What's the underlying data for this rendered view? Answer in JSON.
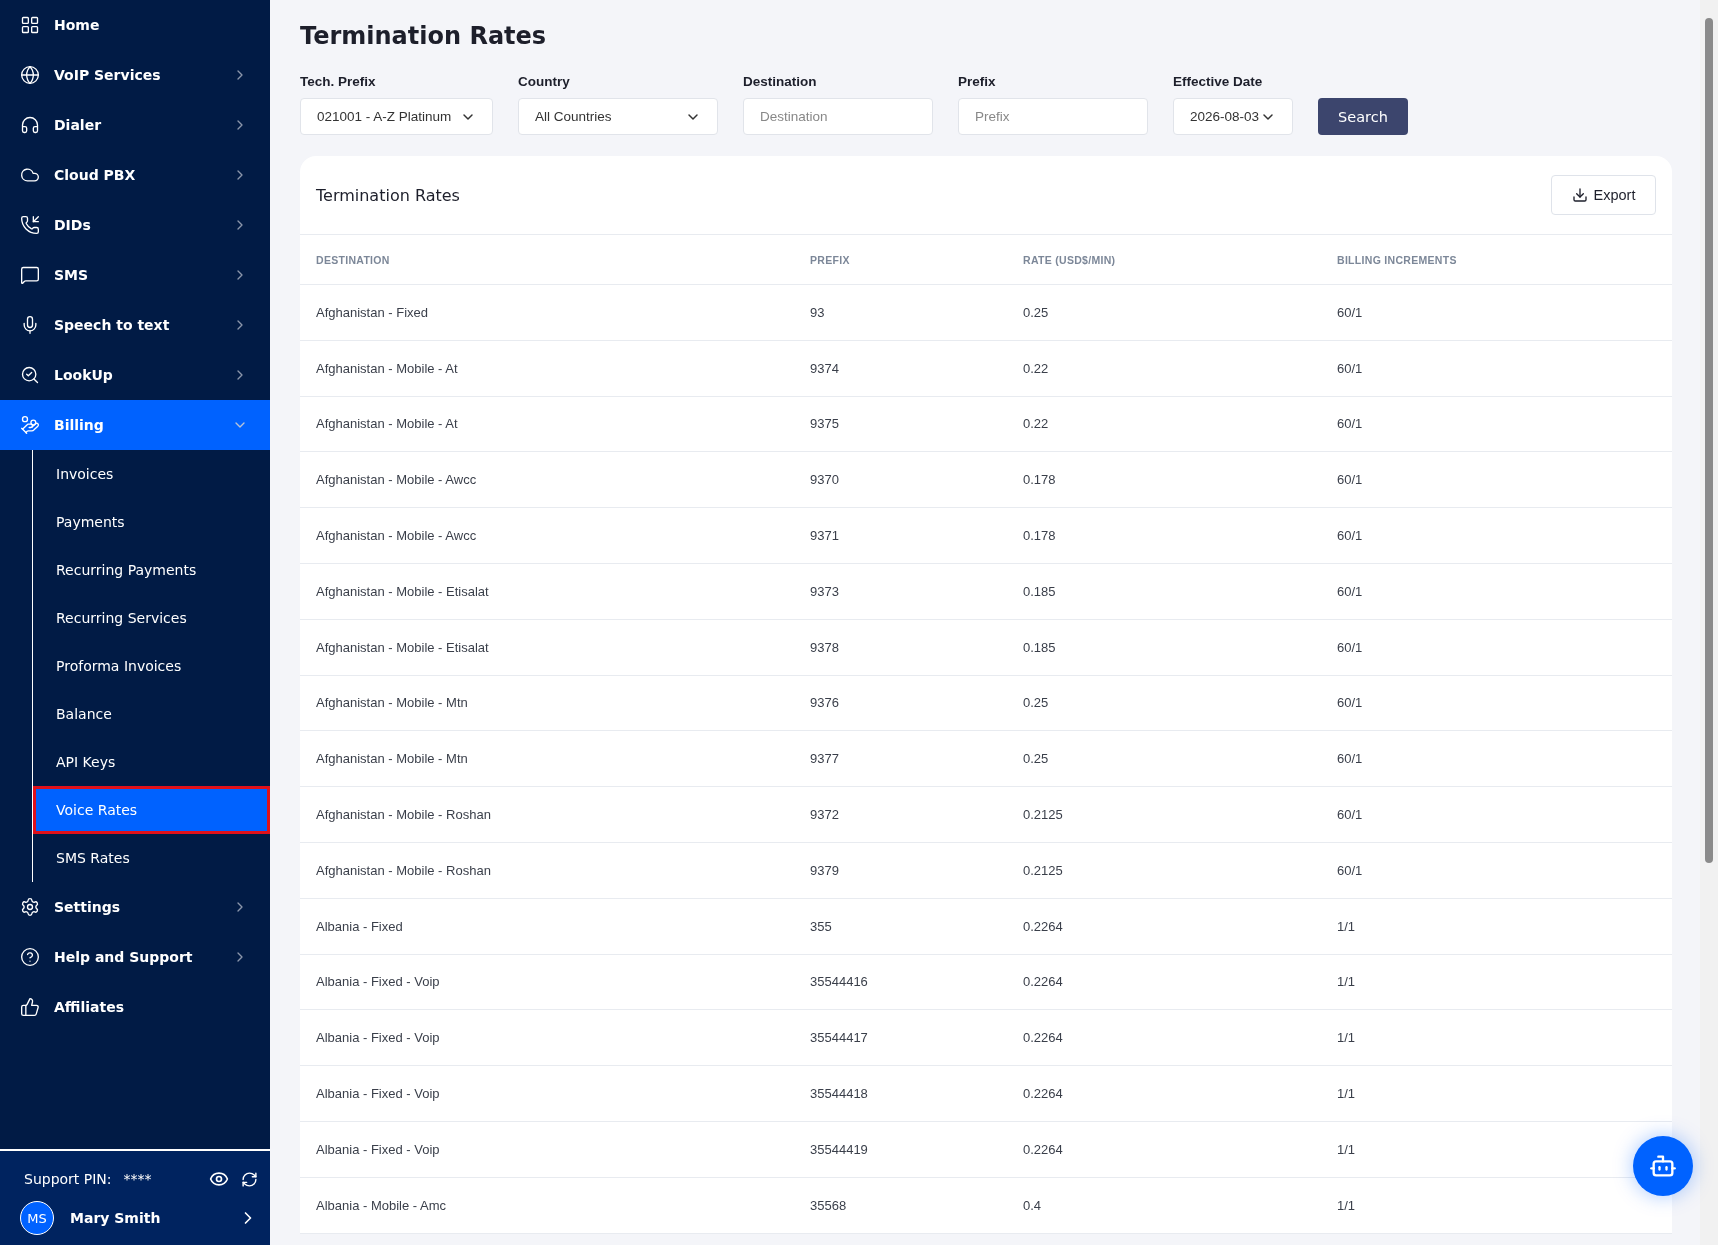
{
  "sidebar": {
    "items": [
      {
        "label": "Home",
        "kind": "link"
      },
      {
        "label": "VoIP Services",
        "kind": "menu",
        "expanded": false
      },
      {
        "label": "Dialer",
        "kind": "menu",
        "expanded": false
      },
      {
        "label": "Cloud PBX",
        "kind": "menu",
        "expanded": false
      },
      {
        "label": "DIDs",
        "kind": "menu",
        "expanded": false
      },
      {
        "label": "SMS",
        "kind": "menu",
        "expanded": false
      },
      {
        "label": "Speech to text",
        "kind": "menu",
        "expanded": false
      },
      {
        "label": "LookUp",
        "kind": "menu",
        "expanded": false
      },
      {
        "label": "Billing",
        "kind": "menu",
        "expanded": true,
        "children": [
          {
            "label": "Invoices",
            "selected": false
          },
          {
            "label": "Payments",
            "selected": false
          },
          {
            "label": "Recurring Payments",
            "selected": false
          },
          {
            "label": "Recurring Services",
            "selected": false
          },
          {
            "label": "Proforma Invoices",
            "selected": false
          },
          {
            "label": "Balance",
            "selected": false
          },
          {
            "label": "API Keys",
            "selected": false
          },
          {
            "label": "Voice Rates",
            "selected": true
          },
          {
            "label": "SMS Rates",
            "selected": false
          }
        ]
      },
      {
        "label": "Settings",
        "kind": "menu",
        "expanded": false
      },
      {
        "label": "Help and Support",
        "kind": "menu",
        "expanded": false
      },
      {
        "label": "Affiliates",
        "kind": "link"
      }
    ],
    "footer": {
      "pin_label": "Support PIN:",
      "pin_value": "****",
      "user_initials": "MS",
      "user_name": "Mary Smith"
    }
  },
  "page_title": "Termination Rates",
  "filters": [
    {
      "label": "Tech. Prefix",
      "kind": "select",
      "value": "021001 - A-Z Platinum"
    },
    {
      "label": "Country",
      "kind": "select",
      "value": "All Countries"
    },
    {
      "label": "Destination",
      "kind": "input",
      "placeholder": "Destination"
    },
    {
      "label": "Prefix",
      "kind": "input",
      "placeholder": "Prefix"
    },
    {
      "label": "Effective Date",
      "kind": "select",
      "value": "2026-08-03"
    }
  ],
  "search_button": "Search",
  "card": {
    "title": "Termination Rates",
    "export_button": "Export",
    "table": {
      "columns": [
        "DESTINATION",
        "PREFIX",
        "RATE (USD$/MIN)",
        "BILLING INCREMENTS"
      ],
      "rows": [
        [
          "Afghanistan - Fixed",
          "93",
          "0.25",
          "60/1"
        ],
        [
          "Afghanistan - Mobile - At",
          "9374",
          "0.22",
          "60/1"
        ],
        [
          "Afghanistan - Mobile - At",
          "9375",
          "0.22",
          "60/1"
        ],
        [
          "Afghanistan - Mobile - Awcc",
          "9370",
          "0.178",
          "60/1"
        ],
        [
          "Afghanistan - Mobile - Awcc",
          "9371",
          "0.178",
          "60/1"
        ],
        [
          "Afghanistan - Mobile - Etisalat",
          "9373",
          "0.185",
          "60/1"
        ],
        [
          "Afghanistan - Mobile - Etisalat",
          "9378",
          "0.185",
          "60/1"
        ],
        [
          "Afghanistan - Mobile - Mtn",
          "9376",
          "0.25",
          "60/1"
        ],
        [
          "Afghanistan - Mobile - Mtn",
          "9377",
          "0.25",
          "60/1"
        ],
        [
          "Afghanistan - Mobile - Roshan",
          "9372",
          "0.2125",
          "60/1"
        ],
        [
          "Afghanistan - Mobile - Roshan",
          "9379",
          "0.2125",
          "60/1"
        ],
        [
          "Albania - Fixed",
          "355",
          "0.2264",
          "1/1"
        ],
        [
          "Albania - Fixed - Voip",
          "35544416",
          "0.2264",
          "1/1"
        ],
        [
          "Albania - Fixed - Voip",
          "35544417",
          "0.2264",
          "1/1"
        ],
        [
          "Albania - Fixed - Voip",
          "35544418",
          "0.2264",
          "1/1"
        ],
        [
          "Albania - Fixed - Voip",
          "35544419",
          "0.2264",
          "1/1"
        ],
        [
          "Albania - Mobile - Amc",
          "35568",
          "0.4",
          "1/1"
        ]
      ]
    }
  }
}
